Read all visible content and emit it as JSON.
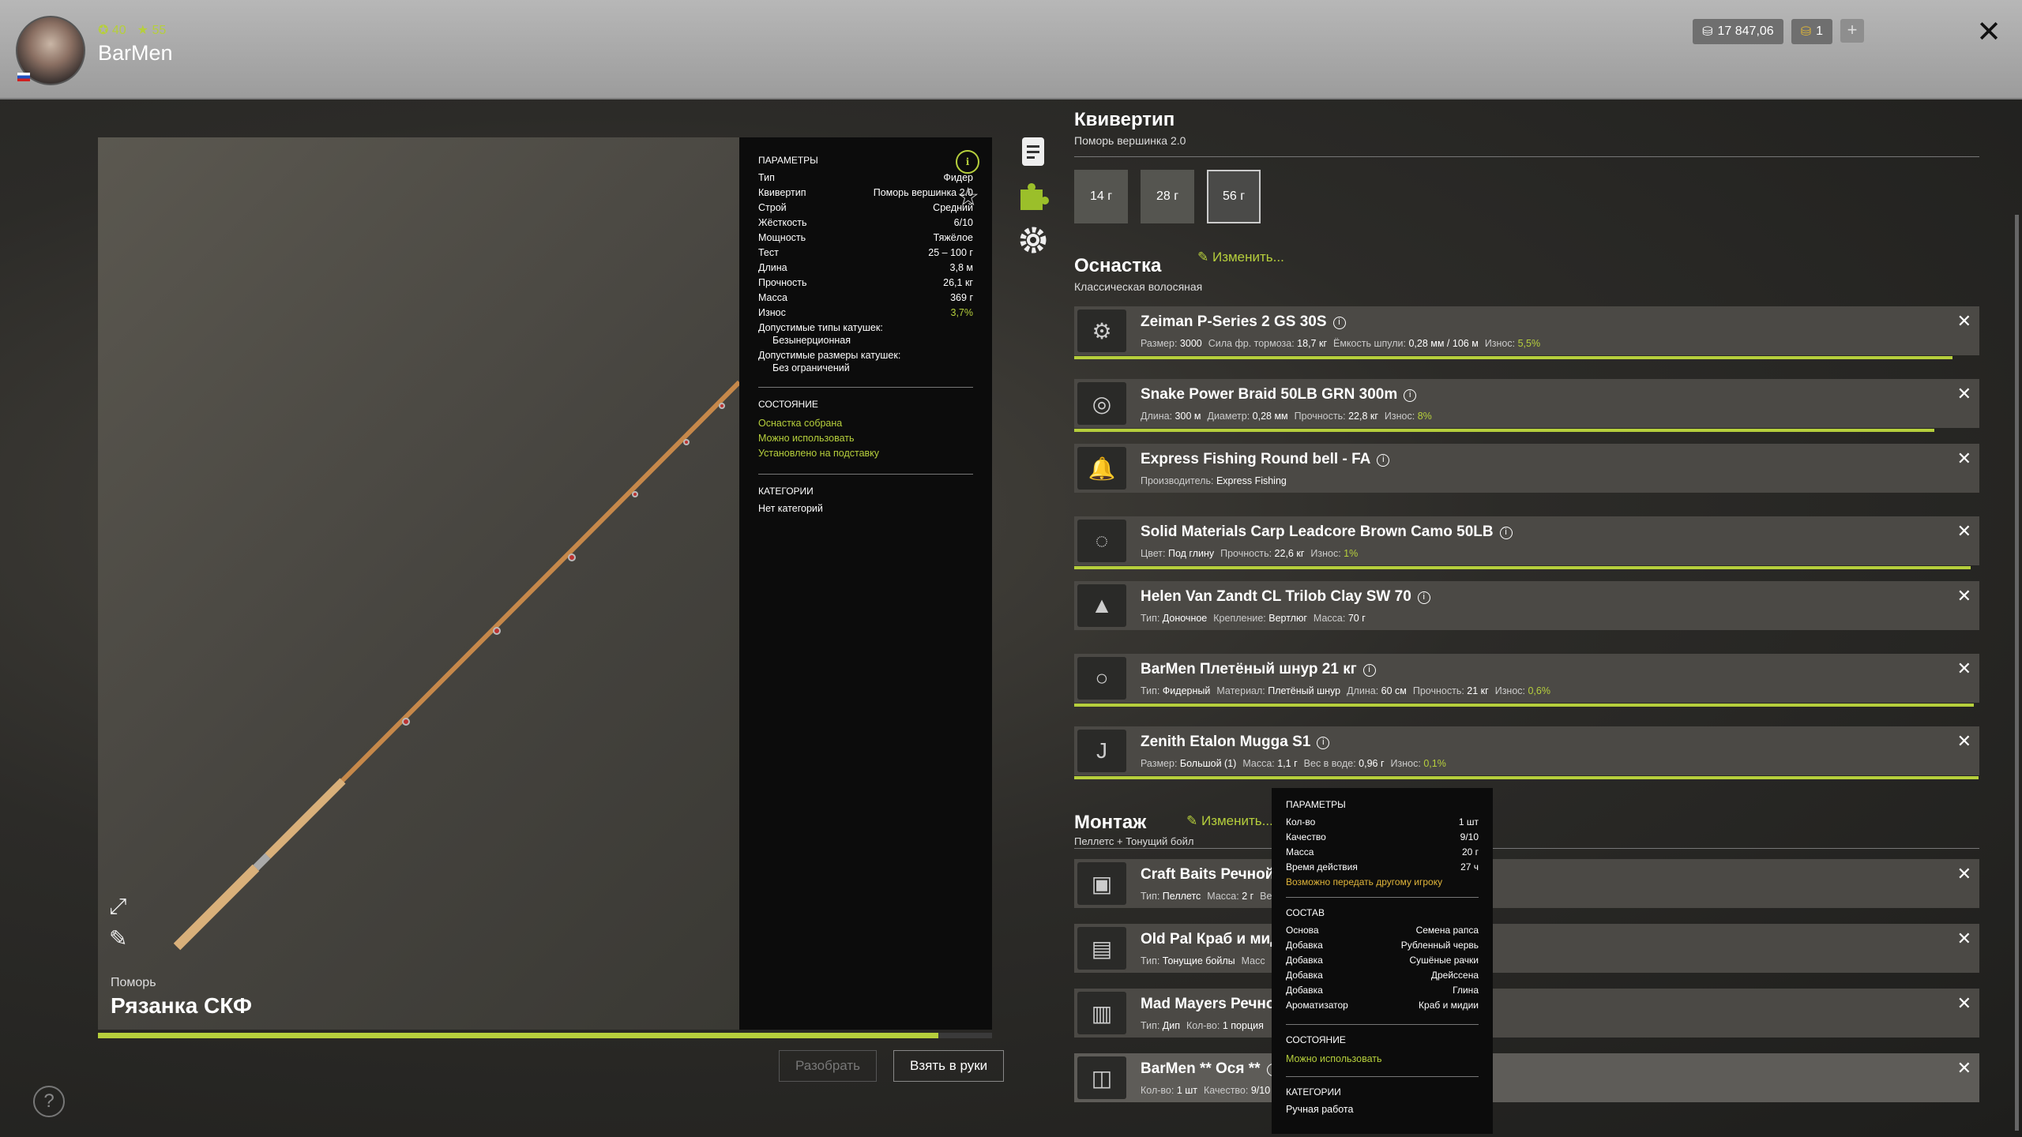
{
  "player": {
    "name": "BarMen",
    "level": "40",
    "rank": "55"
  },
  "currency": {
    "silver": "17 847,06",
    "gold": "1",
    "add": "+"
  },
  "rod": {
    "brand": "Поморь",
    "name": "Рязанка СКФ",
    "wear_fraction": 0.94
  },
  "params": {
    "title": "ПАРАМЕТРЫ",
    "rows": [
      {
        "k": "Тип",
        "v": "Фидер"
      },
      {
        "k": "Квивертип",
        "v": "Поморь вершинка 2.0"
      },
      {
        "k": "Строй",
        "v": "Средний"
      },
      {
        "k": "Жёсткость",
        "v": "6/10"
      },
      {
        "k": "Мощность",
        "v": "Тяжёлое"
      },
      {
        "k": "Тест",
        "v": "25 – 100 г"
      },
      {
        "k": "Длина",
        "v": "3,8 м"
      },
      {
        "k": "Прочность",
        "v": "26,1 кг"
      },
      {
        "k": "Масса",
        "v": "369 г"
      },
      {
        "k": "Износ",
        "v": "3,7%"
      }
    ],
    "reel_types_label": "Допустимые типы катушек:",
    "reel_types_value": "Безынерционная",
    "reel_sizes_label": "Допустимые размеры катушек:",
    "reel_sizes_value": "Без ограничений",
    "state_title": "СОСТОЯНИЕ",
    "state_lines": [
      "Оснастка собрана",
      "Можно использовать",
      "Установлено на подставку"
    ],
    "cat_title": "КАТЕГОРИИ",
    "cat_value": "Нет категорий"
  },
  "buttons": {
    "disassemble": "Разобрать",
    "take": "Взять в руки"
  },
  "quivertip": {
    "title": "Квивертип",
    "subtitle": "Поморь вершинка 2.0",
    "options": [
      "14 г",
      "28 г",
      "56 г"
    ],
    "selected": "56 г"
  },
  "tackle": {
    "title": "Оснастка",
    "subtitle": "Классическая волосяная",
    "edit": "Изменить...",
    "items": [
      {
        "name": "Zeiman P-Series 2 GS 30S",
        "icon": "reel-icon",
        "props": [
          [
            "Размер:",
            "3000"
          ],
          [
            "Сила фр. тормоза:",
            "18,7 кг"
          ],
          [
            "Ёмкость шпули:",
            "0,28 мм / 106 м"
          ],
          [
            "Износ:",
            "5,5%"
          ]
        ],
        "wear": 0.97
      },
      {
        "name": "Snake Power Braid 50LB GRN 300m",
        "icon": "line-spool-icon",
        "props": [
          [
            "Длина:",
            "300 м"
          ],
          [
            "Диаметр:",
            "0,28 мм"
          ],
          [
            "Прочность:",
            "22,8 кг"
          ],
          [
            "Износ:",
            "8%"
          ]
        ],
        "wear": 0.95
      },
      {
        "name": "Express Fishing Round bell - FA",
        "icon": "bell-icon",
        "props": [
          [
            "Производитель:",
            "Express Fishing"
          ]
        ],
        "wear": 0
      },
      {
        "name": "Solid Materials Carp Leadcore Brown Camo 50LB",
        "icon": "leadcore-icon",
        "props": [
          [
            "Цвет:",
            "Под глину"
          ],
          [
            "Прочность:",
            "22,6 кг"
          ],
          [
            "Износ:",
            "1%"
          ]
        ],
        "wear": 0.99
      },
      {
        "name": "Helen Van Zandt CL Trilob Clay SW 70",
        "icon": "sinker-icon",
        "props": [
          [
            "Тип:",
            "Доночное"
          ],
          [
            "Крепление:",
            "Вертлюг"
          ],
          [
            "Масса:",
            "70 г"
          ]
        ],
        "wear": 0
      },
      {
        "name": "BarMen Плетёный шнур 21 кг",
        "icon": "braid-leader-icon",
        "props": [
          [
            "Тип:",
            "Фидерный"
          ],
          [
            "Материал:",
            "Плетёный шнур"
          ],
          [
            "Длина:",
            "60 см"
          ],
          [
            "Прочность:",
            "21 кг"
          ],
          [
            "Износ:",
            "0,6%"
          ]
        ],
        "wear": 0.994
      },
      {
        "name": "Zenith Etalon Mugga S1",
        "icon": "hook-icon",
        "props": [
          [
            "Размер:",
            "Большой (1)"
          ],
          [
            "Масса:",
            "1,1 г"
          ],
          [
            "Вес в воде:",
            "0,96 г"
          ],
          [
            "Износ:",
            "0,1%"
          ]
        ],
        "wear": 0.999
      }
    ]
  },
  "montage": {
    "title": "Монтаж",
    "subtitle": "Пеллетс + Тонущий бойл",
    "edit": "Изменить...",
    "items": [
      {
        "name": "Craft Baits Речной р",
        "icon": "pellet-jar-icon",
        "props": [
          [
            "Тип:",
            "Пеллетс"
          ],
          [
            "Масса:",
            "2 г"
          ],
          [
            "Ве",
            ""
          ]
        ]
      },
      {
        "name": "Old Pal Краб и мид",
        "icon": "boilie-jar-icon",
        "props": [
          [
            "Тип:",
            "Тонущие бойлы"
          ],
          [
            "Масс",
            ""
          ]
        ],
        "tail": "шт"
      },
      {
        "name": "Mad Mayers Речно",
        "icon": "dip-jar-icon",
        "props": [
          [
            "Тип:",
            "Дип"
          ],
          [
            "Кол-во:",
            "1 порция"
          ]
        ]
      },
      {
        "name": "BarMen ** Ося **",
        "icon": "groundbait-bag-icon",
        "props": [
          [
            "Кол-во:",
            "1 шт"
          ],
          [
            "Качество:",
            "9/10"
          ]
        ]
      }
    ]
  },
  "tooltip": {
    "params_title": "ПАРАМЕТРЫ",
    "rows": [
      {
        "k": "Кол-во",
        "v": "1 шт"
      },
      {
        "k": "Качество",
        "v": "9/10"
      },
      {
        "k": "Масса",
        "v": "20 г"
      },
      {
        "k": "Время действия",
        "v": "27 ч"
      }
    ],
    "transfer": "Возможно передать другому игроку",
    "comp_title": "СОСТАВ",
    "comp": [
      {
        "k": "Основа",
        "v": "Семена рапса"
      },
      {
        "k": "Добавка",
        "v": "Рубленный червь"
      },
      {
        "k": "Добавка",
        "v": "Сушёные рачки"
      },
      {
        "k": "Добавка",
        "v": "Дрейссена"
      },
      {
        "k": "Добавка",
        "v": "Глина"
      },
      {
        "k": "Ароматизатор",
        "v": "Краб и мидии"
      }
    ],
    "state_title": "СОСТОЯНИЕ",
    "state": "Можно использовать",
    "cat_title": "КАТЕГОРИИ",
    "cat": "Ручная работа"
  }
}
